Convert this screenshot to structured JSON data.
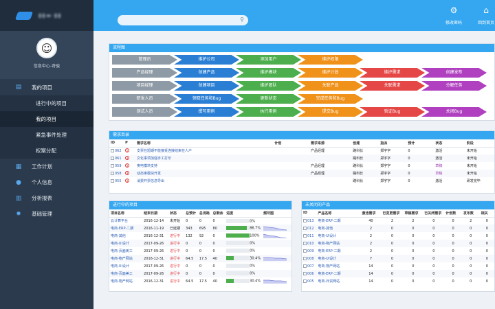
{
  "brand": {
    "name": "▮▮▬·▮▮"
  },
  "profile": {
    "name": "信息中心-奇骏"
  },
  "nav": {
    "my_project": "我的项目",
    "sub": [
      "进行中的项目",
      "我的项目",
      "紧急事件处理",
      "权案分配"
    ],
    "work_plan": "工作计划",
    "personal": "个人信息",
    "analysis": "分析报表",
    "basic": "基础管理"
  },
  "topbar": {
    "search_placeholder": "",
    "btn1": "修改密码",
    "btn2": "回到首页"
  },
  "flow": {
    "title": "流程图",
    "rows": [
      [
        "管理员",
        "维护公司",
        "添加用户",
        "维护权限"
      ],
      [
        "产品经理",
        "创建产品",
        "维护模块",
        "维护计划",
        "维护需求",
        "创建发布"
      ],
      [
        "项目经理",
        "创建项目",
        "维护团队",
        "关联产品",
        "关联需求",
        "分解任务"
      ],
      [
        "研发人员",
        "领取任务和Bug",
        "更新状态",
        "完成任务和Bug"
      ],
      [
        "测试人员",
        "撰写用例",
        "执行用例",
        "提交Bug",
        "验证Bug",
        "关闭Bug"
      ]
    ]
  },
  "req": {
    "title": "需求目录",
    "headers": [
      "ID",
      "P",
      "需求名称",
      "计划",
      "需求来源",
      "创建",
      "指派",
      "预计",
      "状态",
      "阶段"
    ],
    "rows": [
      [
        "062",
        "1",
        "支票在短期不能接受连接结束在人户",
        "",
        "产品经理",
        "路科长",
        "郑宇字",
        "0",
        "激活",
        "未开始"
      ],
      [
        "061",
        "3",
        "文化事项加强手工打印",
        "",
        "",
        "路科长",
        "郑宇字",
        "0",
        "激活",
        "未开始"
      ],
      [
        "059",
        "3",
        "奥电模块支持",
        "",
        "产品经理",
        "路科长",
        "郑宇字",
        "0",
        "草稿",
        "未开始"
      ],
      [
        "058",
        "3",
        "动态审模块开发",
        "",
        "产品经理",
        "路科长",
        "郑宇字",
        "0",
        "草稿",
        "未开始"
      ],
      [
        "055",
        "3",
        "消费开票信息导出",
        "",
        "",
        "路科长",
        "郑宇字",
        "0",
        "激活",
        "研发完毕"
      ]
    ]
  },
  "proj": {
    "title": "进行中的项目",
    "headers": [
      "项目名称",
      "结束日期",
      "状态",
      "总预计",
      "总消耗",
      "总剩余",
      "进度",
      "燃尽图"
    ],
    "rows": [
      [
        "云计算平台",
        "2016-12-14",
        "未开始",
        "0",
        "0",
        "0",
        "0%"
      ],
      [
        "电商-ERP-二期",
        "2016-11-19",
        "已延期",
        "343",
        "695",
        "80",
        "86.7%"
      ],
      [
        "电商-其他",
        "2016-12-31",
        "进行中",
        "132",
        "92",
        "0",
        "100%"
      ],
      [
        "电商-UI设计",
        "2017-09-26",
        "进行中",
        "0",
        "0",
        "0",
        "0%"
      ],
      [
        "电商-页面美工",
        "2017-09-26",
        "进行中",
        "0",
        "0",
        "0",
        "0%"
      ],
      [
        "电商-物产网站",
        "2016-12-31",
        "进行中",
        "64.5",
        "17.5",
        "40",
        "30.4%"
      ],
      [
        "电商-UI设计",
        "2017-09-26",
        "进行中",
        "0",
        "0",
        "0",
        "0%"
      ],
      [
        "电商-页面美工",
        "2017-09-26",
        "进行中",
        "0",
        "0",
        "0",
        "0%"
      ],
      [
        "电商-物产网站",
        "2016-12-31",
        "进行中",
        "64.5",
        "17.5",
        "40",
        "30.4%"
      ]
    ]
  },
  "prod": {
    "title": "未关闭的产品",
    "headers": [
      "ID",
      "产品名称",
      "激活需求",
      "已变更需求",
      "草稿需求",
      "已关闭需求",
      "计划数",
      "发布数",
      "相关"
    ],
    "rows": [
      [
        "013",
        "电商-ERP-二期",
        "40",
        "2",
        "2",
        "0",
        "0",
        "2",
        "0"
      ],
      [
        "012",
        "电商-其他",
        "2",
        "0",
        "0",
        "0",
        "0",
        "0",
        "0"
      ],
      [
        "011",
        "电商-UI设计",
        "2",
        "0",
        "0",
        "0",
        "0",
        "0",
        "0"
      ],
      [
        "010",
        "电商-物产网站",
        "2",
        "0",
        "0",
        "0",
        "0",
        "0",
        "0"
      ],
      [
        "009",
        "电商-ERP-二期",
        "2",
        "0",
        "0",
        "0",
        "0",
        "0",
        "0"
      ],
      [
        "008",
        "电商-UI设计",
        "7",
        "0",
        "0",
        "0",
        "0",
        "0",
        "0"
      ],
      [
        "007",
        "电商-物产网站",
        "14",
        "0",
        "0",
        "0",
        "0",
        "0",
        "0"
      ],
      [
        "006",
        "电商-ERP-二期",
        "14",
        "0",
        "0",
        "0",
        "0",
        "0",
        "0"
      ],
      [
        "005",
        "电商-外贸网站",
        "14",
        "0",
        "0",
        "0",
        "0",
        "0",
        "0"
      ]
    ]
  },
  "colors": {
    "accent": "#35a7f0",
    "sidebar": "#2b3a4c"
  }
}
